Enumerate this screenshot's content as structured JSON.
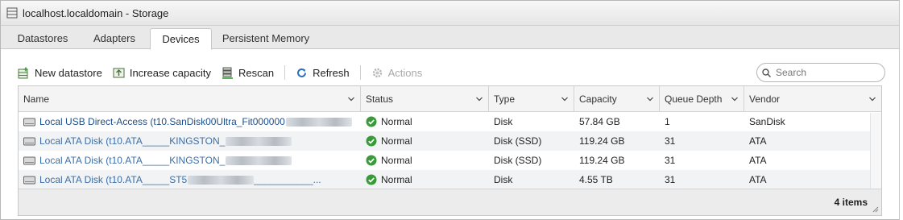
{
  "window": {
    "title": "localhost.localdomain - Storage"
  },
  "tabs": [
    {
      "label": "Datastores",
      "active": false
    },
    {
      "label": "Adapters",
      "active": false
    },
    {
      "label": "Devices",
      "active": true
    },
    {
      "label": "Persistent Memory",
      "active": false
    }
  ],
  "toolbar": {
    "new_datastore": "New datastore",
    "increase_capacity": "Increase capacity",
    "rescan": "Rescan",
    "refresh": "Refresh",
    "actions": "Actions"
  },
  "search": {
    "placeholder": "Search",
    "value": ""
  },
  "table": {
    "columns": [
      "Name",
      "Status",
      "Type",
      "Capacity",
      "Queue Depth",
      "Vendor"
    ],
    "rows": [
      {
        "name": "Local USB Direct-Access (t10.SanDisk00Ultra_Fit000000",
        "status": "Normal",
        "type": "Disk",
        "capacity": "57.84 GB",
        "queue_depth": "1",
        "vendor": "SanDisk"
      },
      {
        "name": "Local ATA Disk (t10.ATA_____KINGSTON_",
        "status": "Normal",
        "type": "Disk (SSD)",
        "capacity": "119.24 GB",
        "queue_depth": "31",
        "vendor": "ATA"
      },
      {
        "name": "Local ATA Disk (t10.ATA_____KINGSTON_",
        "status": "Normal",
        "type": "Disk (SSD)",
        "capacity": "119.24 GB",
        "queue_depth": "31",
        "vendor": "ATA"
      },
      {
        "name": "Local ATA Disk (t10.ATA_____ST5",
        "status": "Normal",
        "type": "Disk",
        "capacity": "4.55 TB",
        "queue_depth": "31",
        "vendor": "ATA"
      }
    ],
    "row_suffixes": [
      "",
      "",
      "",
      "___________..."
    ],
    "footer": "4 items"
  },
  "colors": {
    "link": "#3c6fa8",
    "status_ok": "#3a9a3a",
    "refresh_icon": "#2a6fc0"
  }
}
